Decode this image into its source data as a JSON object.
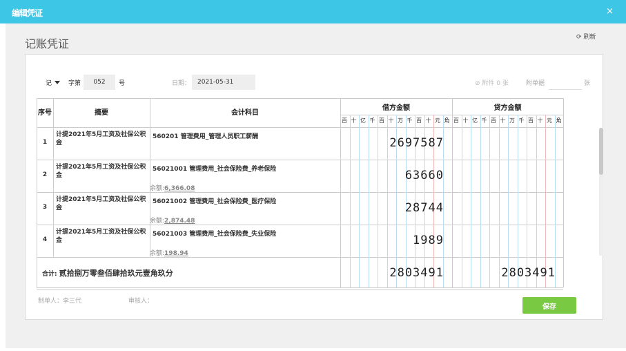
{
  "window": {
    "title": "编辑凭证",
    "close_glyph": "×"
  },
  "page": {
    "title": "记账凭证",
    "refresh_label": "刷新"
  },
  "header": {
    "voucher_type": "记",
    "number_prefix": "字第",
    "number": "052",
    "number_suffix": "号",
    "date_label": "日期：",
    "date": "2021-05-31",
    "attachments_label": "附件 0 张",
    "doc_label": "附单据",
    "doc_unit": "张"
  },
  "table": {
    "headers": {
      "seq": "序号",
      "summary": "摘要",
      "subject": "会计科目",
      "debit": "借方金额",
      "credit": "贷方金额"
    },
    "digit_units": [
      "百",
      "十",
      "亿",
      "千",
      "百",
      "十",
      "万",
      "千",
      "百",
      "十",
      "元",
      "角"
    ],
    "rows": [
      {
        "no": "1",
        "summary": "计提2021年5月工资及社保公积金",
        "subject": "560201 管理费用_管理人员职工薪酬",
        "balance_label": "",
        "balance": "",
        "debit": "2697587",
        "credit": ""
      },
      {
        "no": "2",
        "summary": "计提2021年5月工资及社保公积金",
        "subject": "56021001 管理费用_社会保险费_养老保险",
        "balance_label": "余额:",
        "balance": "6,366.08",
        "debit": "63660",
        "credit": ""
      },
      {
        "no": "3",
        "summary": "计提2021年5月工资及社保公积金",
        "subject": "56021002 管理费用_社会保险费_医疗保险",
        "balance_label": "余额:",
        "balance": "2,874.48",
        "debit": "28744",
        "credit": ""
      },
      {
        "no": "4",
        "summary": "计提2021年5月工资及社保公积金",
        "subject": "56021003 管理费用_社会保险费_失业保险",
        "balance_label": "余额:",
        "balance": "198.94",
        "debit": "1989",
        "credit": ""
      }
    ],
    "total": {
      "label": "合计:",
      "words": "贰拾捌万零叁佰肆拾玖元壹角玖分",
      "debit": "2803491",
      "credit": "2803491"
    }
  },
  "footer": {
    "maker_label": "制单人：",
    "maker": "李三代",
    "reviewer_label": "审核人：",
    "reviewer": "",
    "save_label": "保存"
  },
  "colors": {
    "header_bg": "#3ec6e6",
    "save_bg": "#7ac943"
  }
}
